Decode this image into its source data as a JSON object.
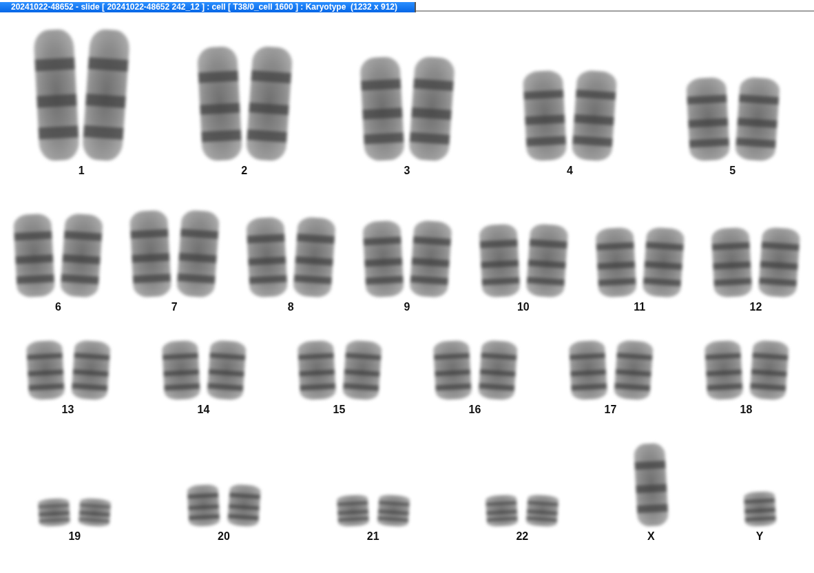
{
  "window": {
    "title": "20241022-48652 - slide [ 20241022-48652 242_12 ] : cell [ T38/0_cell 1600 ] : Karyotype  (1232 x 912)"
  },
  "karyotype": {
    "rows": [
      {
        "chromosomes": [
          {
            "label": "1",
            "kind": "pair"
          },
          {
            "label": "2",
            "kind": "pair"
          },
          {
            "label": "3",
            "kind": "pair"
          },
          {
            "label": "4",
            "kind": "pair"
          },
          {
            "label": "5",
            "kind": "pair"
          }
        ]
      },
      {
        "chromosomes": [
          {
            "label": "6",
            "kind": "pair"
          },
          {
            "label": "7",
            "kind": "pair"
          },
          {
            "label": "8",
            "kind": "pair"
          },
          {
            "label": "9",
            "kind": "pair"
          },
          {
            "label": "10",
            "kind": "pair"
          },
          {
            "label": "11",
            "kind": "pair"
          },
          {
            "label": "12",
            "kind": "pair"
          }
        ]
      },
      {
        "chromosomes": [
          {
            "label": "13",
            "kind": "pair"
          },
          {
            "label": "14",
            "kind": "pair"
          },
          {
            "label": "15",
            "kind": "pair"
          },
          {
            "label": "16",
            "kind": "pair"
          },
          {
            "label": "17",
            "kind": "pair"
          },
          {
            "label": "18",
            "kind": "pair"
          }
        ]
      },
      {
        "chromosomes": [
          {
            "label": "19",
            "kind": "pair"
          },
          {
            "label": "20",
            "kind": "pair"
          },
          {
            "label": "21",
            "kind": "pair"
          },
          {
            "label": "22",
            "kind": "pair"
          },
          {
            "label": "X",
            "kind": "single"
          },
          {
            "label": "Y",
            "kind": "single"
          }
        ]
      }
    ]
  }
}
